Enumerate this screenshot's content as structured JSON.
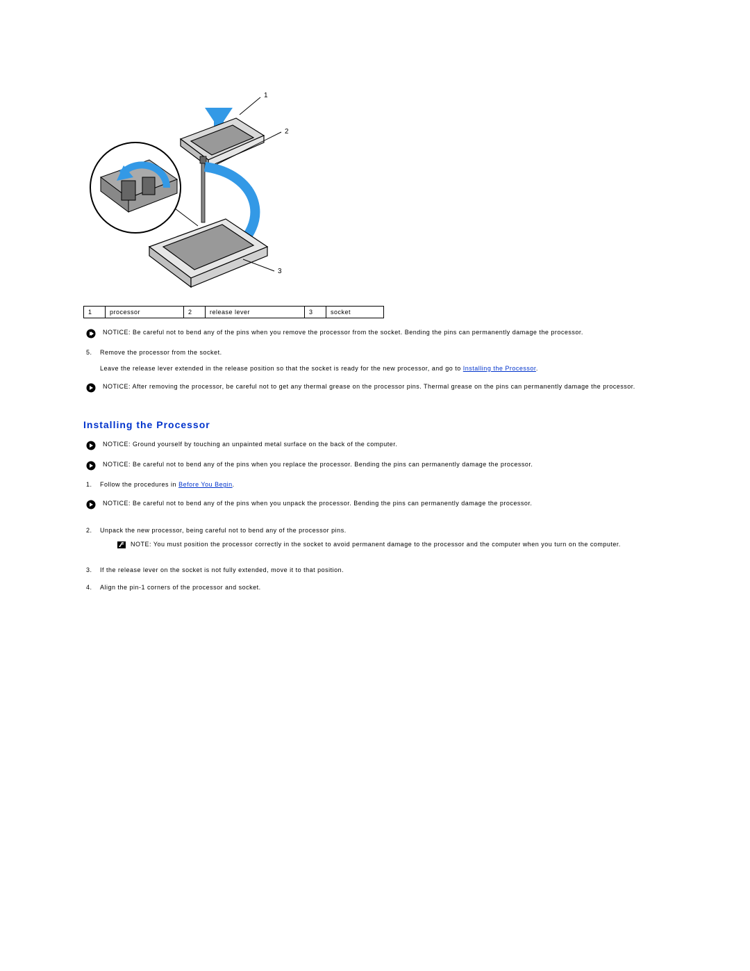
{
  "diagram": {
    "callouts": {
      "c1": "1",
      "c2": "2",
      "c3": "3"
    },
    "table": {
      "n1": "1",
      "l1": "processor",
      "n2": "2",
      "l2": "release lever",
      "n3": "3",
      "l3": "socket"
    }
  },
  "notices": {
    "n1_label": "NOTICE:",
    "n1_text": " Be careful not to bend any of the pins when you remove the processor from the socket. Bending the pins can permanently damage the processor.",
    "n2_label": "NOTICE:",
    "n2_text": " After removing the processor, be careful not to get any thermal grease on the processor pins. Thermal grease on the pins can permanently damage the processor.",
    "n3_label": "NOTICE:",
    "n3_text": " Ground yourself by touching an unpainted metal surface on the back of the computer.",
    "n4_label": "NOTICE:",
    "n4_text": " Be careful not to bend any of the pins when you replace the processor. Bending the pins can permanently damage the processor.",
    "n5_label": "NOTICE:",
    "n5_text": " Be careful not to bend any of the pins when you unpack the processor. Bending the pins can permanently damage the processor."
  },
  "steps_a": {
    "s5_num": "5.",
    "s5_text": "Remove the processor from the socket.",
    "s5_sub_a": "Leave the release lever extended in the release position so that the socket is ready for the new processor, and go to ",
    "s5_link": "Installing the Processor",
    "s5_sub_b": "."
  },
  "section_title": "Installing the Processor",
  "steps_b": {
    "s1_num": "1.",
    "s1_text_a": "Follow the procedures in ",
    "s1_link": "Before You Begin",
    "s1_text_b": ".",
    "s2_num": "2.",
    "s2_text": "Unpack the new processor, being careful not to bend any of the processor pins.",
    "note_label": "NOTE:",
    "note_text": " You must position the processor correctly in the socket to avoid permanent damage to the processor and the computer when you turn on the computer.",
    "s3_num": "3.",
    "s3_text": "If the release lever on the socket is not fully extended, move it to that position.",
    "s4_num": "4.",
    "s4_text": "Align the pin-1 corners of the processor and socket."
  }
}
